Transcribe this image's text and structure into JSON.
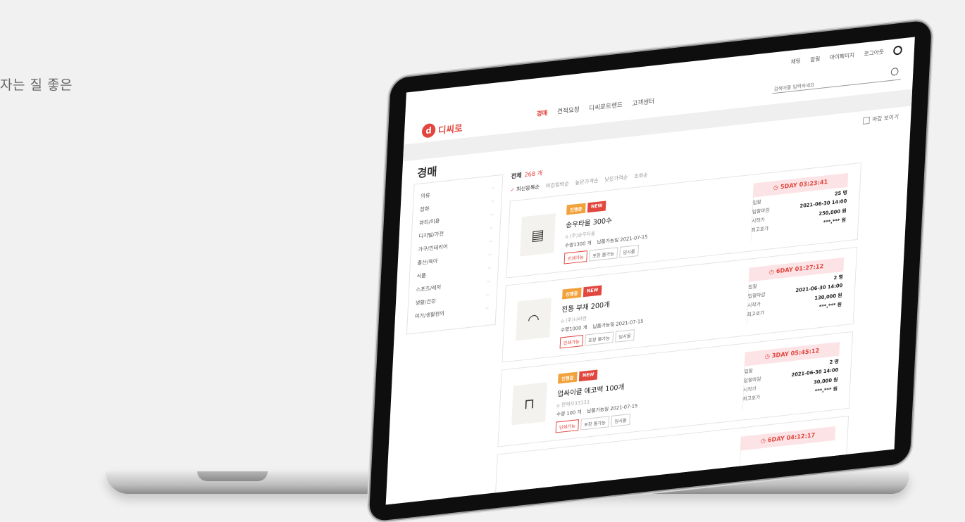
{
  "caption": "자는 질 좋은",
  "header": {
    "top_links": [
      "채팅",
      "알림",
      "마이페이지",
      "로그아웃"
    ],
    "logo_text": "디씨로",
    "logo_mark": "d",
    "nav": [
      {
        "label": "경매"
      },
      {
        "label": "견적요청"
      },
      {
        "label": "디씨로트렌드"
      },
      {
        "label": "고객센터"
      }
    ],
    "search_placeholder": "검색어를 입력하세요"
  },
  "page": {
    "title": "경매",
    "closed_toggle_label": "마감 보이기"
  },
  "sidebar": {
    "categories": [
      {
        "label": "의류"
      },
      {
        "label": "잡화"
      },
      {
        "label": "뷰티/미용"
      },
      {
        "label": "디지털/가전"
      },
      {
        "label": "가구/인테리어"
      },
      {
        "label": "출산/육아"
      },
      {
        "label": "식품"
      },
      {
        "label": "스포츠/레저"
      },
      {
        "label": "생활/건강"
      },
      {
        "label": "여가/생활편의"
      }
    ]
  },
  "listing": {
    "total_label": "전체",
    "total_count": "268 개",
    "sorts": [
      "최신등록순",
      "마감임박순",
      "높은가격순",
      "낮은가격순",
      "조회순"
    ],
    "row_labels": {
      "bids": "입찰",
      "deadline": "입찰마감",
      "start": "시작가",
      "max": "최고호가"
    },
    "items": [
      {
        "badge_ing": "진행중",
        "badge_new": "NEW",
        "name": "송우타올 300수",
        "seller": "(주)송우타올",
        "qty": "수량1300 개",
        "delivery": "납품가능일 2021-07-15",
        "tags": [
          "인쇄가능",
          "포장 불가능",
          "임시몰"
        ],
        "timer": "5DAY 03:23:41",
        "bids": "25 명",
        "deadline": "2021-06-30 14:00",
        "start_price": "250,000 원",
        "max_price": "***,*** 원",
        "thumb": "towel-image"
      },
      {
        "badge_ing": "진행중",
        "badge_new": "NEW",
        "name": "전통 부채 200개",
        "seller": "(주)나라한",
        "qty": "수량1000 개",
        "delivery": "납품가능일 2021-07-15",
        "tags": [
          "인쇄가능",
          "포장 불가능",
          "임시몰"
        ],
        "timer": "6DAY 01:27:12",
        "bids": "2 명",
        "deadline": "2021-06-30 14:00",
        "start_price": "130,000 원",
        "max_price": "***,*** 원",
        "thumb": "fan-image"
      },
      {
        "badge_ing": "진행중",
        "badge_new": "NEW",
        "name": "업싸이클 에코백 100개",
        "seller": "판매자33333",
        "qty": "수량 100 개",
        "delivery": "납품가능일 2021-07-15",
        "tags": [
          "인쇄가능",
          "포장 불가능",
          "임시몰"
        ],
        "timer": "3DAY 05:45:12",
        "bids": "2 명",
        "deadline": "2021-06-30 14:00",
        "start_price": "30,000 원",
        "max_price": "***,*** 원",
        "thumb": "ecobag-image"
      },
      {
        "timer": "6DAY 04:12:17"
      }
    ]
  }
}
